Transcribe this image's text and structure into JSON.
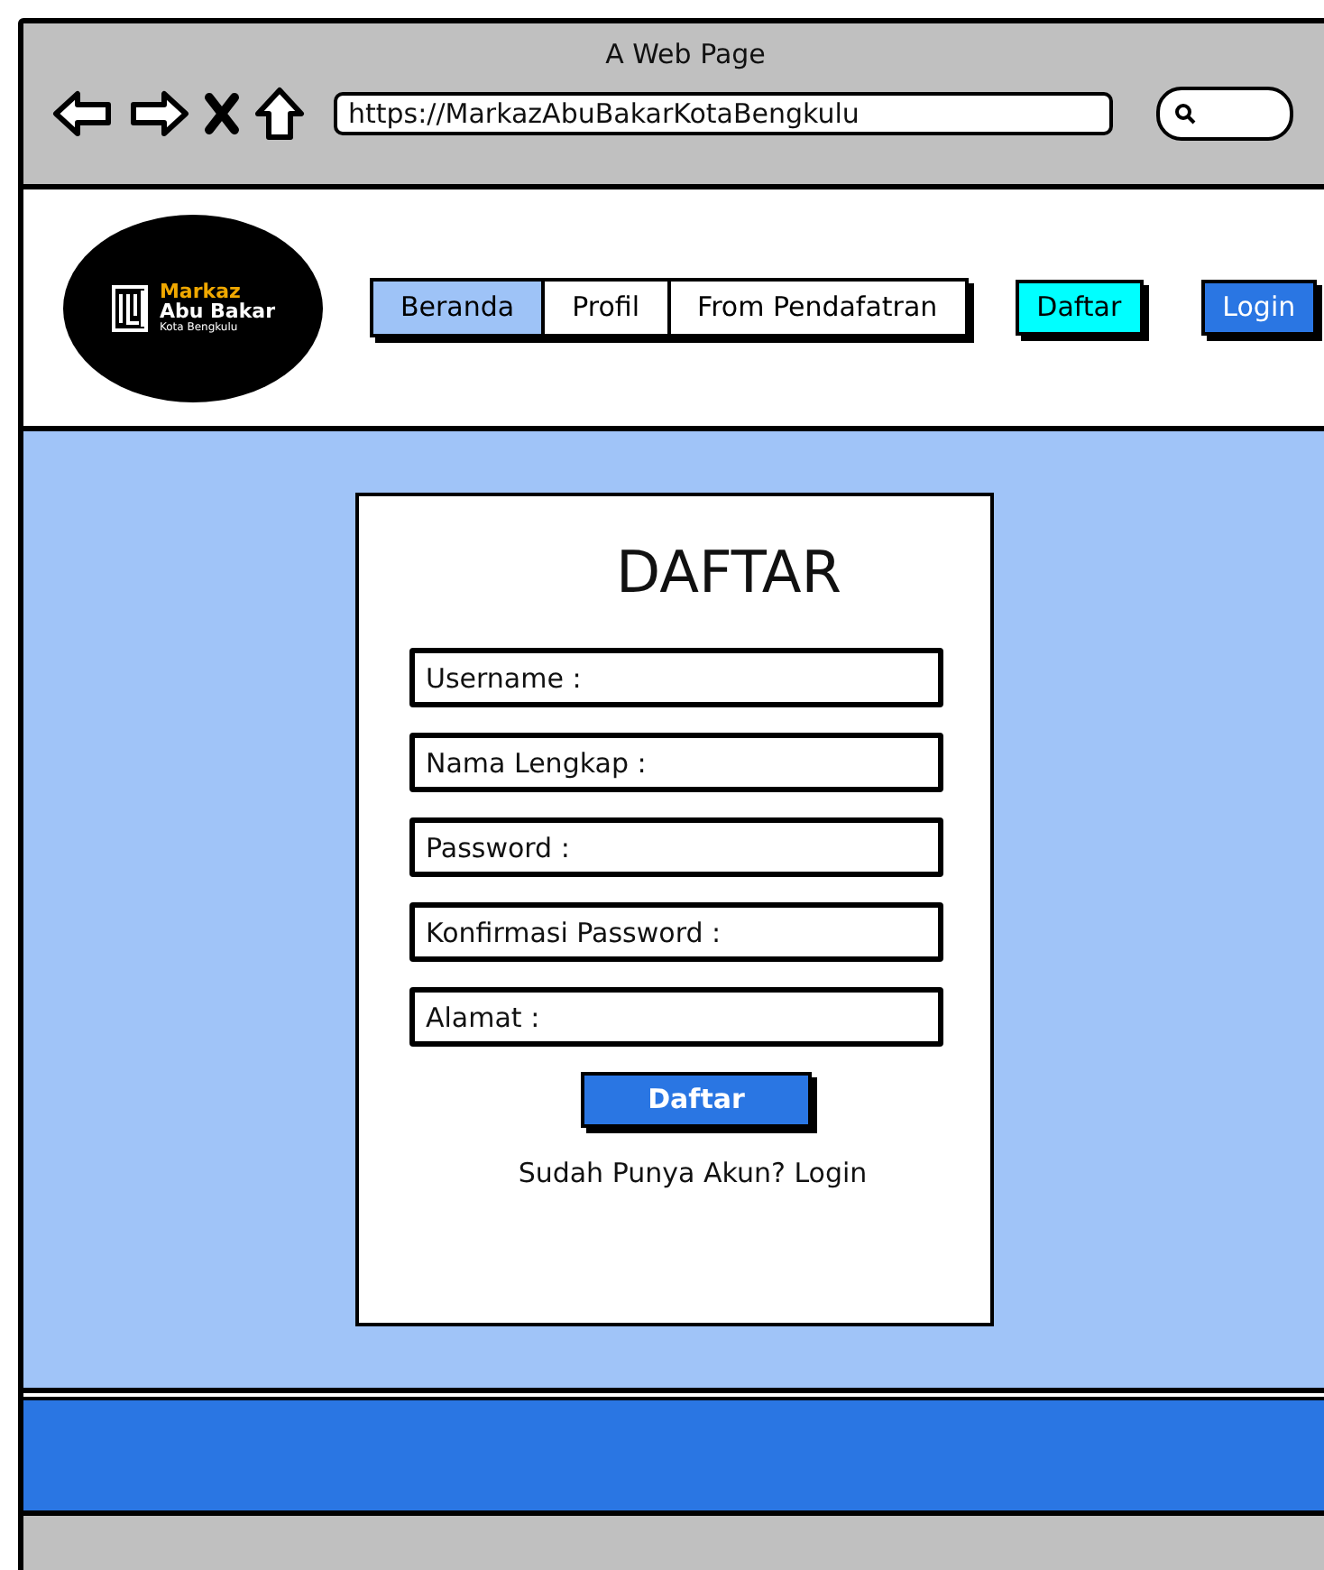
{
  "window": {
    "title": "A Web Page",
    "url": "https://MarkazAbuBakarKotaBengkulu"
  },
  "logo": {
    "line_1": "Markaz",
    "line_2": "Abu Bakar",
    "line_3": "Kota Bengkulu"
  },
  "nav_tabs": [
    {
      "label": "Beranda",
      "selected": true
    },
    {
      "label": "Profil",
      "selected": false
    },
    {
      "label": "From Pendafatran",
      "selected": false
    }
  ],
  "header_buttons": [
    {
      "label": "Daftar",
      "color": "#00ffff"
    },
    {
      "label": "Login",
      "color": "#2a76e3"
    }
  ],
  "form": {
    "title": "DAFTAR",
    "fields": [
      {
        "placeholder": "Username :"
      },
      {
        "placeholder": "Nama Lengkap :"
      },
      {
        "placeholder": "Password :"
      },
      {
        "placeholder": "Konfirmasi Password :"
      },
      {
        "placeholder": "Alamat :"
      }
    ],
    "submit": "Daftar",
    "footer_text": "Sudah Punya Akun? Login"
  }
}
